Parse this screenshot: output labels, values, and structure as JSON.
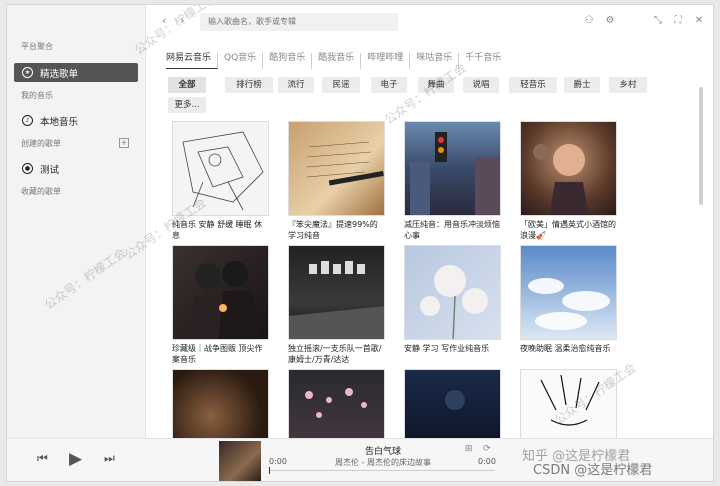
{
  "sidebar": {
    "section_platform": "平台聚合",
    "featured": "精选歌单",
    "section_my_music": "我的音乐",
    "local_music": "本地音乐",
    "section_created": "创建的歌单",
    "playlist_test": "测试",
    "section_collected": "收藏的歌单"
  },
  "topbar": {
    "search_placeholder": "输入歌曲名，歌手或专辑"
  },
  "source_tabs": [
    "网易云音乐",
    "QQ音乐",
    "酷狗音乐",
    "酷我音乐",
    "哔哩哔哩",
    "咪咕音乐",
    "千千音乐"
  ],
  "categories": [
    "全部",
    "排行榜",
    "流行",
    "民谣",
    "电子",
    "舞曲",
    "说唱",
    "轻音乐",
    "爵士",
    "乡村",
    "更多..."
  ],
  "playlists": [
    {
      "title": "纯音乐 安静 舒缓 睡眠 休息"
    },
    {
      "title": "『笨尖魔法』提速99%的学习纯音"
    },
    {
      "title": "减压纯音：用音乐冲淡烦恼心事"
    },
    {
      "title": "「欧美」情遇英式小酒馆的浪漫🎻"
    },
    {
      "title": "珍藏级｜战争图贩 顶尖作案音乐"
    },
    {
      "title": "独立摇滚/一支乐队一首歌/康姆士/万青/达达"
    },
    {
      "title": "安静 学习 写作业纯音乐"
    },
    {
      "title": "夜晚助眠 温柔治愈纯音乐"
    },
    {
      "title": ""
    },
    {
      "title": ""
    },
    {
      "title": ""
    },
    {
      "title": ""
    }
  ],
  "player": {
    "song": "告白气球",
    "artist": "周杰伦 - 周杰伦的床边故事",
    "time_current": "0:00",
    "time_total": "0:00"
  },
  "watermarks": [
    "公众号：柠檬工会",
    "知乎 @这是柠檬君",
    "CSDN @这是柠檬君"
  ]
}
